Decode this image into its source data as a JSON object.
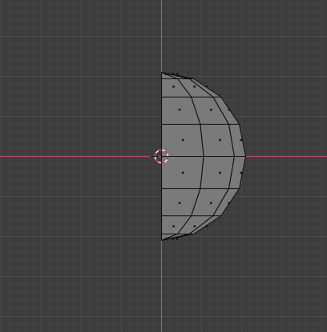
{
  "viewport": {
    "view": "front-orthographic",
    "mode": "edit-mode",
    "colors": {
      "background": "#3d3d3d",
      "grid_minor": "#444444",
      "grid_major": "#4a4a4a",
      "axis_x": "#b84a5e",
      "axis_z": "#4f77ad",
      "mesh_face": "#7a7a7a",
      "mesh_edge": "#111111",
      "face_dot": "#111111",
      "cursor_red": "#cc2a2a",
      "cursor_white": "#f0f0f0"
    }
  },
  "mesh": {
    "object": "half-uv-sphere",
    "rings": 8,
    "visible_segments": 6
  },
  "icons": {
    "cursor": "3d-cursor-icon"
  }
}
